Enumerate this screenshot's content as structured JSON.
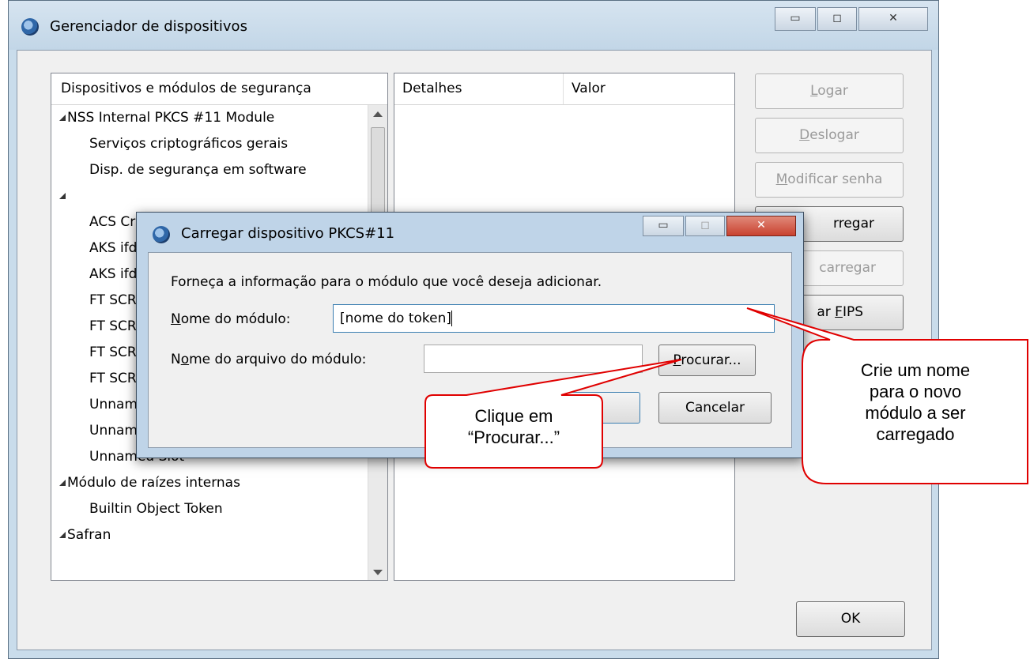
{
  "main_window": {
    "title": "Gerenciador de dispositivos",
    "caption_buttons": {
      "minimize": "▭",
      "maximize": "◻",
      "close": "✕"
    },
    "devices_pane": {
      "header": "Dispositivos e módulos de segurança",
      "rows": [
        {
          "text": "NSS Internal PKCS #11 Module",
          "level": 0,
          "expanded": true
        },
        {
          "text": "Serviços criptográficos gerais",
          "level": 1
        },
        {
          "text": "Disp. de segurança em software",
          "level": 1
        },
        {
          "text": "",
          "level": 0,
          "expanded": true
        },
        {
          "text": "ACS Cr",
          "level": 1
        },
        {
          "text": "AKS ifd",
          "level": 1
        },
        {
          "text": "AKS ifd",
          "level": 1
        },
        {
          "text": "FT SCR",
          "level": 1
        },
        {
          "text": "FT SCR",
          "level": 1
        },
        {
          "text": "FT SCR",
          "level": 1
        },
        {
          "text": "FT SCR",
          "level": 1
        },
        {
          "text": "Unnam",
          "level": 1
        },
        {
          "text": "Unnam",
          "level": 1
        },
        {
          "text": "Unnamed Slot",
          "level": 1
        },
        {
          "text": "Módulo de raízes internas",
          "level": 0,
          "expanded": true
        },
        {
          "text": "Builtin Object Token",
          "level": 1
        },
        {
          "text": "Safran",
          "level": 0,
          "expanded": true
        }
      ]
    },
    "details_pane": {
      "col_details": "Detalhes",
      "col_value": "Valor"
    },
    "buttons": {
      "login": {
        "key": "L",
        "rest": "ogar"
      },
      "logout": {
        "key": "D",
        "rest": "eslogar"
      },
      "change_password": {
        "key": "M",
        "rest": "odificar senha"
      },
      "load": {
        "visible": "rregar"
      },
      "unload": {
        "visible": "carregar"
      },
      "fips": {
        "prefix": "ar ",
        "key": "F",
        "rest": "IPS"
      },
      "ok": "OK"
    }
  },
  "dialog": {
    "title": "Carregar dispositivo PKCS#11",
    "instruction": "Forneça a informação para o módulo que você deseja adicionar.",
    "module_name": {
      "key": "N",
      "rest": "ome do módulo:",
      "value": "[nome do token]"
    },
    "module_file": {
      "pre": "N",
      "key": "o",
      "rest": "me do arquivo do módulo:",
      "value": ""
    },
    "browse_button": {
      "key": "P",
      "rest": "rocurar..."
    },
    "cancel_button": "Cancelar"
  },
  "callouts": {
    "browse_hint": [
      "Clique em",
      "“Procurar...”"
    ],
    "name_hint": [
      "Crie um nome",
      "para o novo",
      "módulo a ser",
      "carregado"
    ]
  },
  "colors": {
    "callout_border": "#e00000",
    "window_frame": "#c9dceb",
    "close_button": "#c9412f"
  }
}
